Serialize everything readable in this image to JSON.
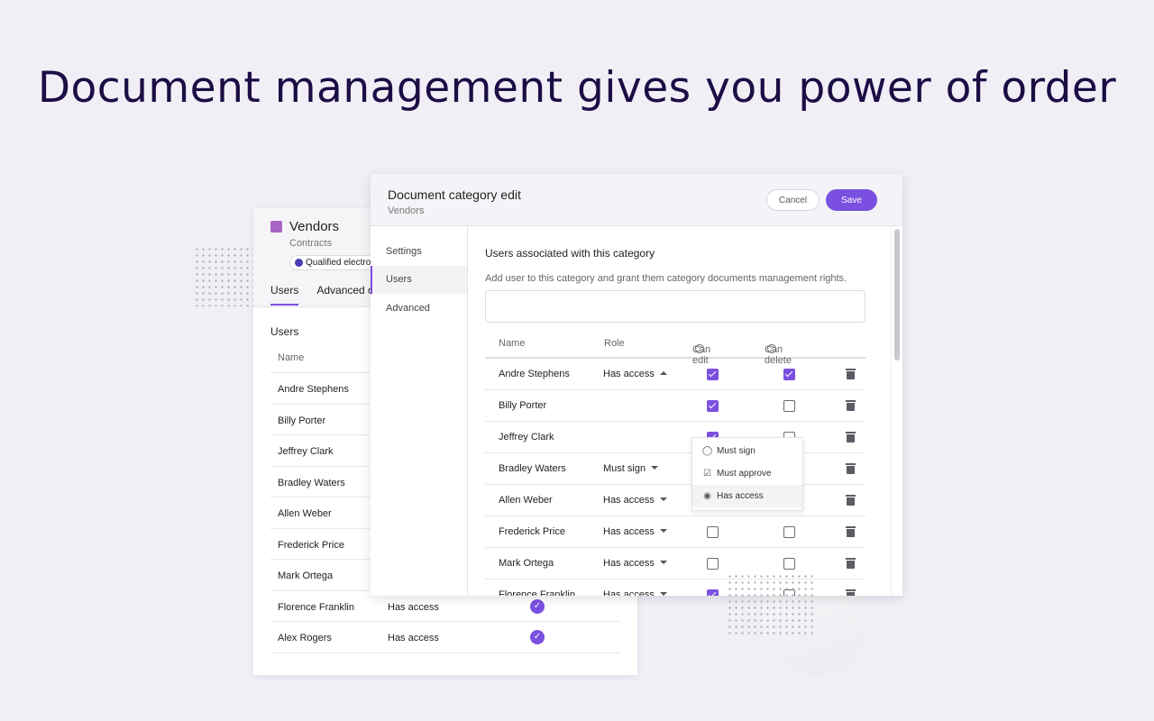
{
  "headline": "Document management gives you power of order",
  "colors": {
    "accent": "#7b4fe0",
    "headline": "#1c0d45",
    "category": "#a764c4"
  },
  "back_card": {
    "title": "Vendors",
    "subtitle": "Contracts",
    "chip": "Qualified electro",
    "tabs": [
      "Users",
      "Advanced o"
    ],
    "section": "Users",
    "name_header": "Name",
    "rows": [
      {
        "name": "Andre Stephens",
        "role": "",
        "check": false
      },
      {
        "name": "Billy Porter",
        "role": "",
        "check": false
      },
      {
        "name": "Jeffrey Clark",
        "role": "",
        "check": false
      },
      {
        "name": "Bradley Waters",
        "role": "",
        "check": false
      },
      {
        "name": "Allen Weber",
        "role": "",
        "check": false
      },
      {
        "name": "Frederick Price",
        "role": "",
        "check": false
      },
      {
        "name": "Mark Ortega",
        "role": "",
        "check": false
      },
      {
        "name": "Florence Franklin",
        "role": "Has access",
        "check": true
      },
      {
        "name": "Alex Rogers",
        "role": "Has access",
        "check": true
      }
    ]
  },
  "modal": {
    "title": "Document category edit",
    "subtitle": "Vendors",
    "cancel": "Cancel",
    "save": "Save",
    "nav": [
      {
        "label": "Settings"
      },
      {
        "label": "Users",
        "active": true
      },
      {
        "label": "Advanced"
      }
    ],
    "heading": "Users associated with this category",
    "description": "Add user to this category and grant them category documents management rights.",
    "search_value": "",
    "columns": {
      "name": "Name",
      "role": "Role",
      "can_edit": "Can edit",
      "can_delete": "Can delete"
    },
    "rows": [
      {
        "name": "Andre Stephens",
        "role": "Has access",
        "edit": true,
        "delete": true,
        "open": true
      },
      {
        "name": "Billy Porter",
        "role": "",
        "edit": true,
        "delete": false
      },
      {
        "name": "Jeffrey Clark",
        "role": "",
        "edit": true,
        "delete": false
      },
      {
        "name": "Bradley Waters",
        "role": "Must sign",
        "edit": true,
        "delete": true
      },
      {
        "name": "Allen Weber",
        "role": "Has access",
        "edit": false,
        "delete": false
      },
      {
        "name": "Frederick Price",
        "role": "Has access",
        "edit": false,
        "delete": false
      },
      {
        "name": "Mark Ortega",
        "role": "Has access",
        "edit": false,
        "delete": false
      },
      {
        "name": "Florence Franklin",
        "role": "Has access",
        "edit": true,
        "delete": false
      }
    ],
    "dropdown": [
      {
        "label": "Must sign",
        "icon": "check-circle-icon"
      },
      {
        "label": "Must approve",
        "icon": "clipboard-check-icon"
      },
      {
        "label": "Has access",
        "icon": "eye-icon",
        "selected": true
      }
    ]
  }
}
